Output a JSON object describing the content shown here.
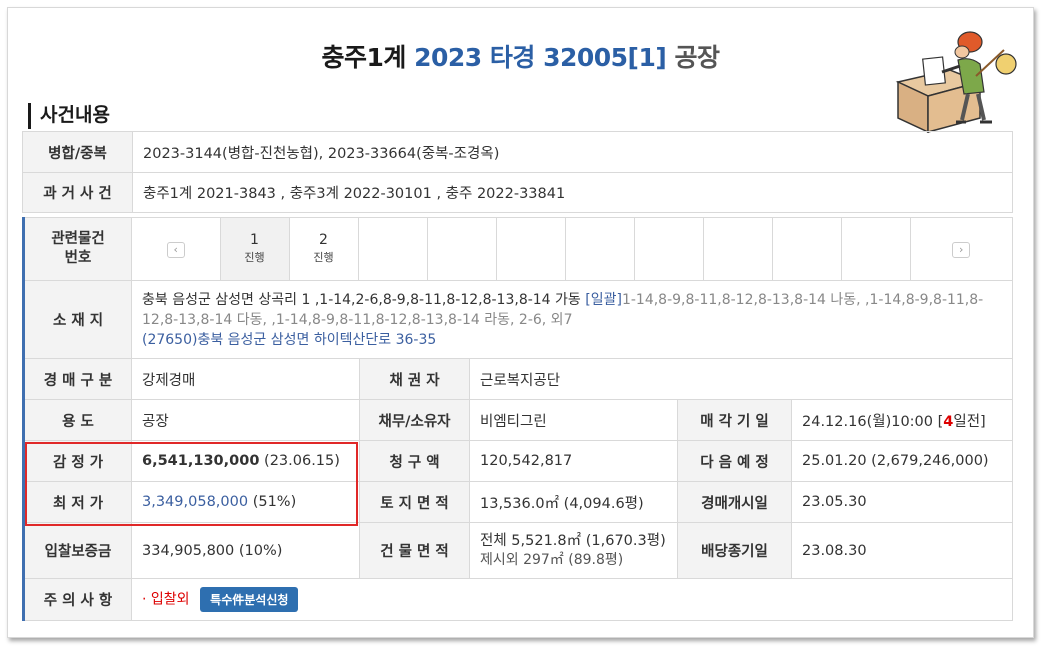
{
  "title": {
    "court": "충주1계",
    "case_number": "2023 타경 32005[1]",
    "type": "공장"
  },
  "section_title": "사건내용",
  "merge": {
    "label": "병합/중복",
    "value": "2023-3144(병합-진천농협), 2023-33664(중복-조경옥)"
  },
  "past_cases": {
    "label": "과 거 사 건",
    "value": "충주1계 2021-3843   , 충주3계 2022-30101   , 충주 2022-33841"
  },
  "related_items": {
    "label_line1": "관련물건",
    "label_line2": "번호",
    "items": [
      {
        "num": "1",
        "status": "진행"
      },
      {
        "num": "2",
        "status": "진행"
      }
    ]
  },
  "location": {
    "label": "소 재 지",
    "main": "충북 음성군 삼성면 상곡리 1 ,1-14,2-6,8-9,8-11,8-12,8-13,8-14 가동",
    "bulk_link": "[일괄]",
    "rest": "1-14,8-9,8-11,8-12,8-13,8-14 나동, ,1-14,8-9,8-11,8-12,8-13,8-14 다동, ,1-14,8-9,8-11,8-12,8-13,8-14 라동, 2-6, 외7",
    "road_address": "(27650)충북 음성군  삼성면 하이텍산단로  36-35"
  },
  "auction_type": {
    "label": "경 매 구 분",
    "value": "강제경매"
  },
  "creditor": {
    "label": "채 권 자",
    "value": "근로복지공단"
  },
  "usage": {
    "label": "용 도",
    "value": "공장"
  },
  "debtor": {
    "label": "채무/소유자",
    "value": "비엠티그린"
  },
  "sale_date": {
    "label": "매 각 기 일",
    "value_prefix": "24.12.16(월)10:00 [",
    "days": "4",
    "value_suffix": "일전]"
  },
  "appraisal": {
    "label": "감 정 가",
    "amount": "6,541,130,000",
    "date": " (23.06.15)"
  },
  "claim": {
    "label": "청 구 액",
    "value": "120,542,817"
  },
  "next_schedule": {
    "label": "다 음 예 정",
    "value": "25.01.20 (2,679,246,000)"
  },
  "minimum": {
    "label": "최 저 가",
    "amount": "3,349,058,000",
    "percent": " (51%)"
  },
  "land_area": {
    "label": "토 지 면 적",
    "value": "13,536.0㎡ (4,094.6평)"
  },
  "auction_start": {
    "label": "경매개시일",
    "value": "23.05.30"
  },
  "deposit": {
    "label": "입찰보증금",
    "value": "334,905,800 (10%)"
  },
  "building_area": {
    "label": "건 물 면 적",
    "line1": "전체 5,521.8㎡ (1,670.3평)",
    "line2": "제시외 297㎡ (89.8평)"
  },
  "dividend_end": {
    "label": "배당종기일",
    "value": "23.08.30"
  },
  "notes": {
    "label": "주 의 사 항",
    "value": "· 입찰외",
    "button": "특수件분석신청"
  },
  "colors": {
    "accent": "#2b5fa5",
    "highlight_box": "#e02828",
    "days_red": "#dd0000"
  },
  "icons": {
    "prev": "chevron-left-icon",
    "next": "chevron-right-icon",
    "illustration": "auction-man-ballot-box-illustration"
  }
}
